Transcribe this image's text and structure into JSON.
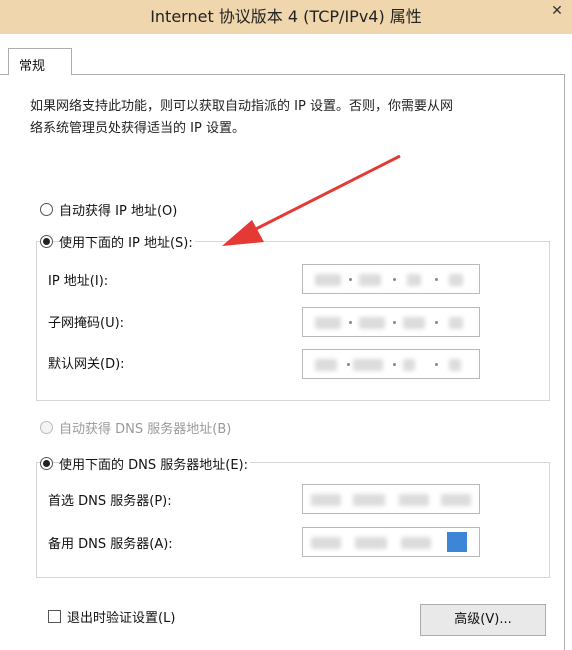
{
  "window": {
    "title": "Internet 协议版本 4 (TCP/IPv4) 属性",
    "close_label": "✕"
  },
  "tabs": [
    {
      "label": "常规"
    }
  ],
  "description": {
    "line1": "如果网络支持此功能，则可以获取自动指派的 IP 设置。否则，你需要从网",
    "line2": "络系统管理员处获得适当的 IP 设置。"
  },
  "ip_section": {
    "auto_label": "自动获得 IP 地址(O)",
    "manual_label": "使用下面的 IP 地址(S):",
    "selected": "manual",
    "fields": [
      {
        "label": "IP 地址(I):"
      },
      {
        "label": "子网掩码(U):"
      },
      {
        "label": "默认网关(D):"
      }
    ]
  },
  "dns_section": {
    "auto_label": "自动获得 DNS 服务器地址(B)",
    "manual_label": "使用下面的 DNS 服务器地址(E):",
    "selected": "manual",
    "fields": [
      {
        "label": "首选 DNS 服务器(P):"
      },
      {
        "label": "备用 DNS 服务器(A):"
      }
    ]
  },
  "validate_checkbox": {
    "label": "退出时验证设置(L)",
    "checked": false
  },
  "advanced_button": {
    "label": "高级(V)..."
  },
  "colors": {
    "titlebar": "#f0d6ad",
    "annotation_arrow": "#e53935",
    "selection": "#3d86d6"
  }
}
